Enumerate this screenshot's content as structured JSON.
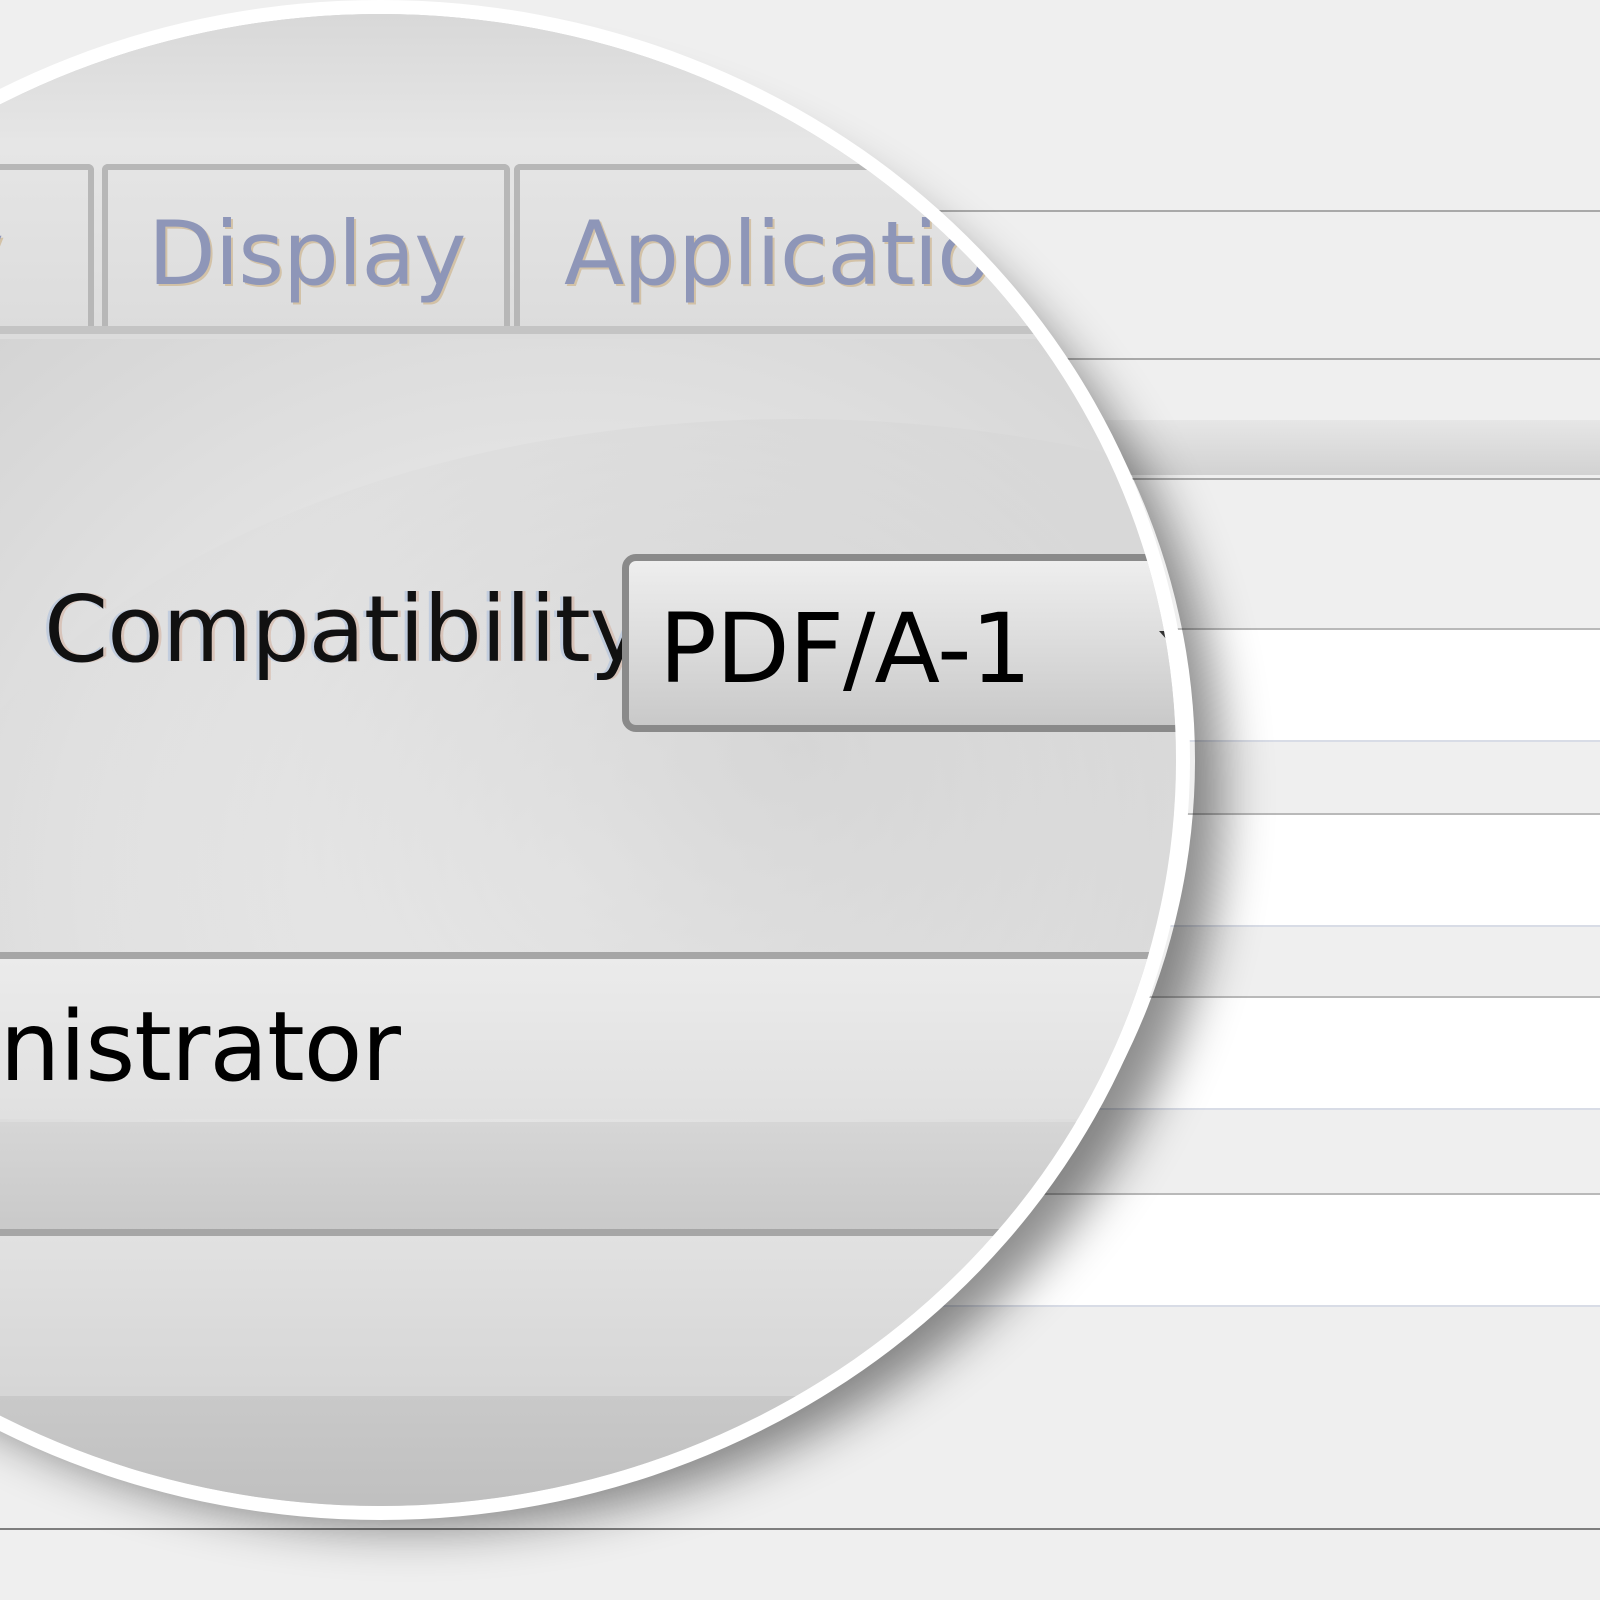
{
  "tabs": [
    {
      "label": "y"
    },
    {
      "label": "Display"
    },
    {
      "label": "Applicatio"
    }
  ],
  "compatibility": {
    "label": "Compatibility",
    "value": "PDF/A-1"
  },
  "row": {
    "text": "inistrator"
  },
  "colors": {
    "tab_text": "#8e96b8",
    "border": "#a9a9a9",
    "background": "#efefef"
  }
}
